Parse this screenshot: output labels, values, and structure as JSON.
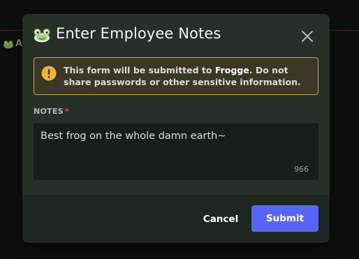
{
  "background": {
    "channel_text": "A"
  },
  "modal": {
    "title": "Enter Employee Notes",
    "title_icon": "frog-icon",
    "close_icon": "close-icon"
  },
  "warning": {
    "icon": "warning-icon",
    "text_before": "This form will be submitted to ",
    "brand": "Frogge",
    "text_after": ". Do not share passwords or other sensitive information."
  },
  "notes": {
    "label": "NOTES",
    "required_marker": "*",
    "value": "Best frog on the whole damn earth~",
    "remaining_count": "966"
  },
  "footer": {
    "cancel_label": "Cancel",
    "submit_label": "Submit"
  },
  "colors": {
    "accent": "#5865f2",
    "warning_border": "#c9a23c",
    "warning_icon": "#f0b232",
    "required": "#f23f43"
  }
}
